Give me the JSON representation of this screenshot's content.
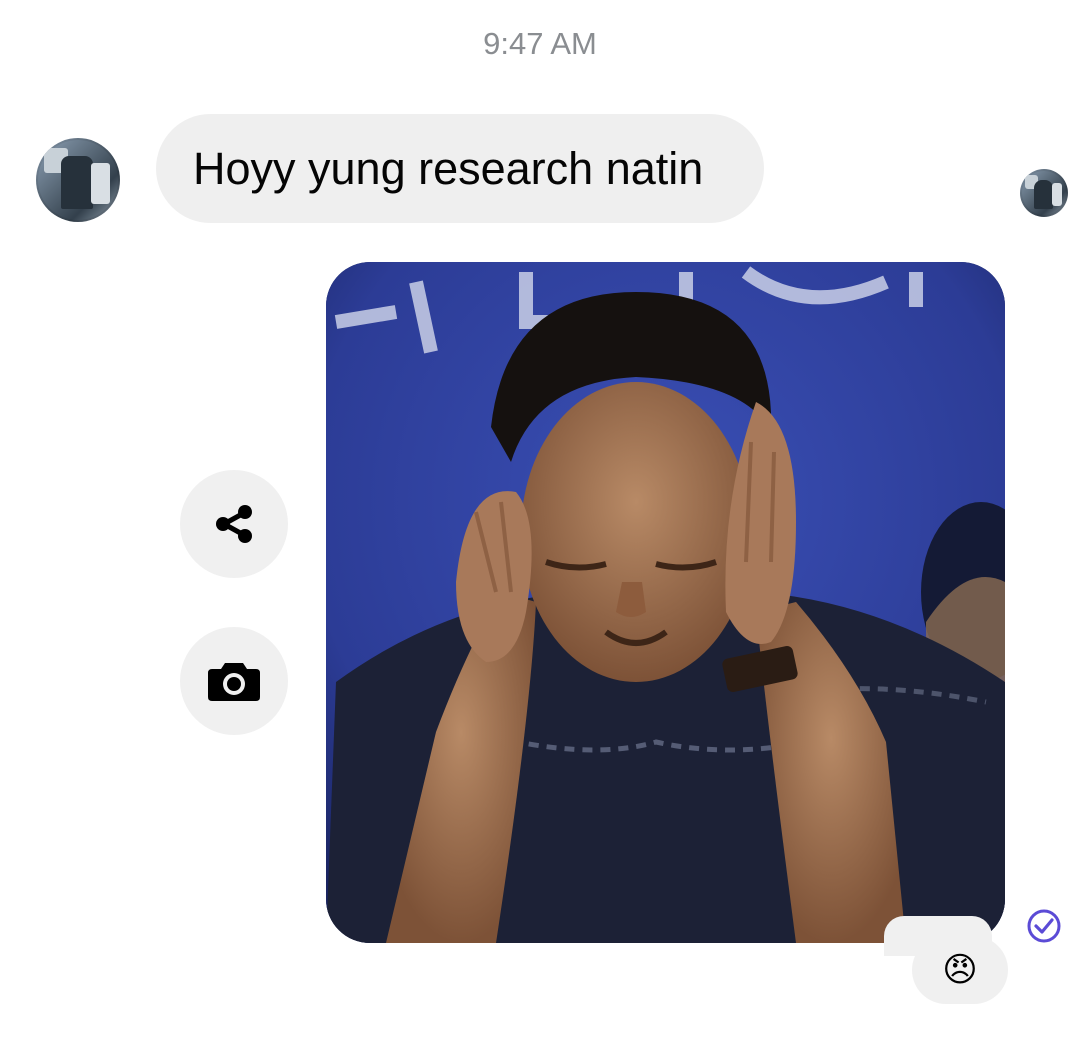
{
  "conversation": {
    "timestamp": "9:47 AM",
    "messages": [
      {
        "type": "text",
        "direction": "incoming",
        "text": "Hoyy yung research natin"
      },
      {
        "type": "image",
        "direction": "outgoing",
        "reaction": "😠",
        "status": "sent"
      }
    ]
  },
  "actions": {
    "share_icon": "share-icon",
    "camera_icon": "camera-icon"
  },
  "colors": {
    "bubble_incoming": "#efefef",
    "timestamp": "#8a8d91",
    "read_receipt": "#5b4bd6",
    "photo_background": "#2f3f9a"
  }
}
